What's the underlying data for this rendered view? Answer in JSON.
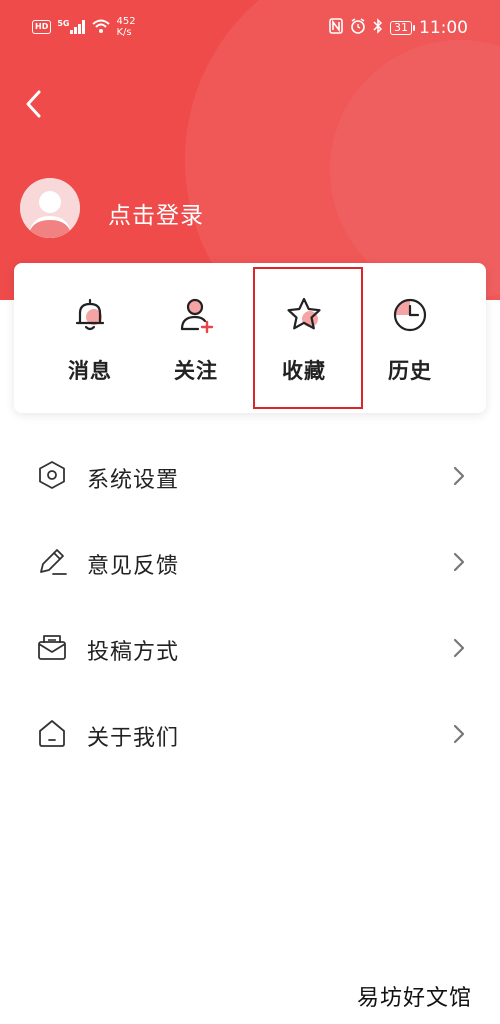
{
  "status_bar": {
    "left_badge": "HD",
    "signal_label": "5G",
    "net_speed_value": "452",
    "net_speed_unit": "K/s",
    "time": "11:00",
    "battery": "31"
  },
  "header": {
    "login_label": "点击登录"
  },
  "quick_actions": [
    {
      "label": "消息",
      "icon": "bell-icon"
    },
    {
      "label": "关注",
      "icon": "add-user-icon"
    },
    {
      "label": "收藏",
      "icon": "star-icon"
    },
    {
      "label": "历史",
      "icon": "clock-icon"
    }
  ],
  "menu": [
    {
      "label": "系统设置",
      "icon": "settings-hexagon-icon"
    },
    {
      "label": "意见反馈",
      "icon": "pencil-icon"
    },
    {
      "label": "投稿方式",
      "icon": "mail-icon"
    },
    {
      "label": "关于我们",
      "icon": "home-icon"
    }
  ],
  "watermark": "易坊好文馆",
  "colors": {
    "header_red": "#ef4b4b",
    "accent_red": "#e8444a",
    "highlight_border": "#d8262b"
  }
}
